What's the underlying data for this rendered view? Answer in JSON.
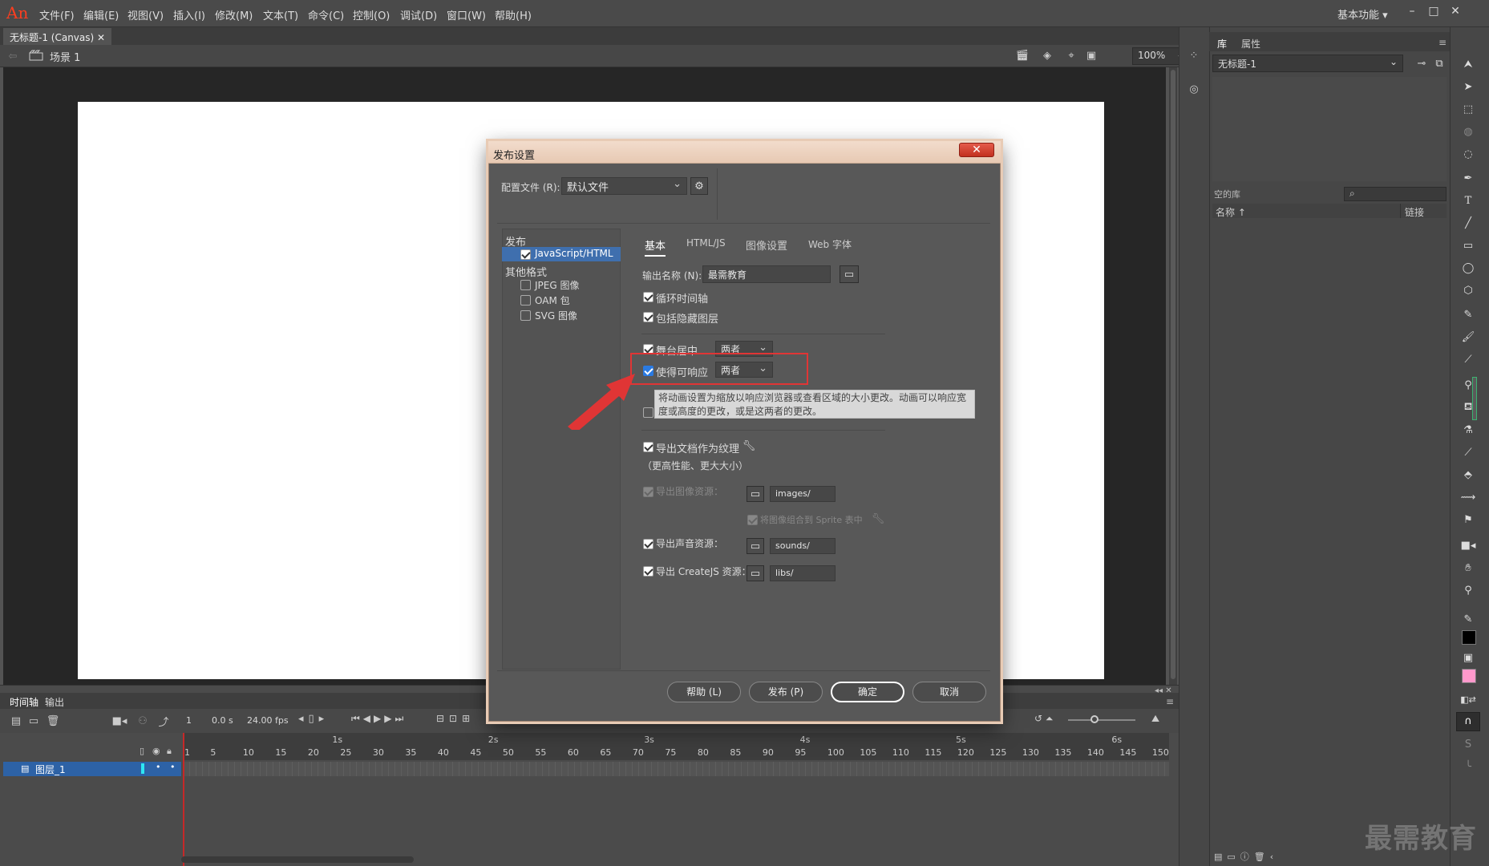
{
  "app": {
    "logo": "An",
    "workspace": "基本功能 ▾"
  },
  "menu": [
    "文件(F)",
    "编辑(E)",
    "视图(V)",
    "插入(I)",
    "修改(M)",
    "文本(T)",
    "命令(C)",
    "控制(O)",
    "调试(D)",
    "窗口(W)",
    "帮助(H)"
  ],
  "document": {
    "tab": "无标题-1 (Canvas)",
    "scene": "场景 1",
    "zoom": "100%"
  },
  "timeline": {
    "tabs": [
      "时间轴",
      "输出"
    ],
    "frame": "1",
    "time": "0.0 s",
    "fps": "24.00 fps",
    "layer": "图层_1",
    "seconds": [
      "1s",
      "2s",
      "3s",
      "4s",
      "5s",
      "6s"
    ],
    "ticks": [
      "1",
      "5",
      "10",
      "15",
      "20",
      "25",
      "30",
      "35",
      "40",
      "45",
      "50",
      "55",
      "60",
      "65",
      "70",
      "75",
      "80",
      "85",
      "90",
      "95",
      "100",
      "105",
      "110",
      "115",
      "120",
      "125",
      "130",
      "135",
      "140",
      "145",
      "150"
    ]
  },
  "library": {
    "tabs": [
      "库",
      "属性"
    ],
    "document": "无标题-1",
    "count": "空的库",
    "col_name": "名称 ↑",
    "col_link": "链接"
  },
  "dialog": {
    "title": "发布设置",
    "close": "✕",
    "profile_label": "配置文件 (R):",
    "profile_value": "默认文件",
    "publish_header": "发布",
    "publish_item": "JavaScript/HTML",
    "other_header": "其他格式",
    "other_items": [
      "JPEG 图像",
      "OAM 包",
      "SVG 图像"
    ],
    "tabs": [
      "基本",
      "HTML/JS",
      "图像设置",
      "Web 字体"
    ],
    "output_label": "输出名称 (N):",
    "output_value": "最需教育",
    "loop": "循环时间轴",
    "include_hidden": "包括隐藏图层",
    "center_stage": "舞台居中",
    "center_value": "两者",
    "responsive": "使得可响应",
    "responsive_value": "两者",
    "tooltip": "将动画设置为缩放以响应浏览器或查看区域的大小更改。动画可以响应宽度或高度的更改，或是这两者的更改。",
    "export_texture": "导出文档作为纹理",
    "texture_note": "（更高性能、更大大小）",
    "export_images": "导出图像资源：",
    "images_path": "images/",
    "sprite": "将图像组合到 Sprite 表中",
    "export_sounds": "导出声音资源：",
    "sounds_path": "sounds/",
    "export_createjs": "导出 CreateJS 资源：",
    "libs_path": "libs/",
    "buttons": {
      "help": "帮助 (L)",
      "publish": "发布 (P)",
      "ok": "确定",
      "cancel": "取消"
    }
  },
  "watermark": "最需教育",
  "colors": {
    "highlight": "#e03535",
    "arrow": "#e03535",
    "selected": "#3f6fae",
    "stroke_swatch": "#000000",
    "fill_swatch": "#ff99cc"
  }
}
